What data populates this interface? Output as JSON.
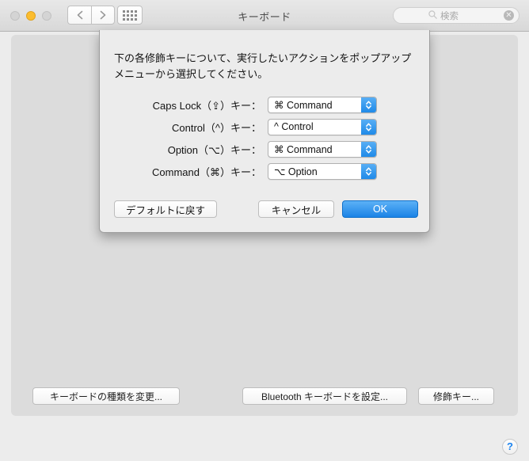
{
  "window": {
    "title": "キーボード"
  },
  "toolbar": {
    "back_icon": "chevron-left-icon",
    "forward_icon": "chevron-right-icon",
    "showall_icon": "grid-icon",
    "traffic": {
      "close": "close-button",
      "minimize": "minimize-button",
      "zoom": "zoom-button"
    }
  },
  "search": {
    "icon": "search-icon",
    "placeholder": "検索",
    "value": "",
    "clear_label": "✕"
  },
  "sheet": {
    "message": "下の各修飾キーについて、実行したいアクションをポップアップメニューから選択してください。",
    "rows": [
      {
        "label": "Caps Lock（⇪）キー：",
        "value": "⌘ Command"
      },
      {
        "label": "Control（^）キー：",
        "value": "^ Control"
      },
      {
        "label": "Option（⌥）キー：",
        "value": "⌘ Command"
      },
      {
        "label": "Command（⌘）キー：",
        "value": "⌥ Option"
      }
    ],
    "buttons": {
      "defaults": "デフォルトに戻す",
      "cancel": "キャンセル",
      "ok": "OK"
    }
  },
  "panel": {
    "buttons": {
      "change_keyboard_type": "キーボードの種類を変更...",
      "setup_bluetooth_keyboard": "Bluetooth キーボードを設定...",
      "modifier_keys": "修飾キー..."
    },
    "help_label": "?"
  },
  "colors": {
    "accent": "#1b83e6",
    "window_bg": "#ececec",
    "panel_bg": "#dcdcdc",
    "minimize": "#fcbd2e"
  }
}
